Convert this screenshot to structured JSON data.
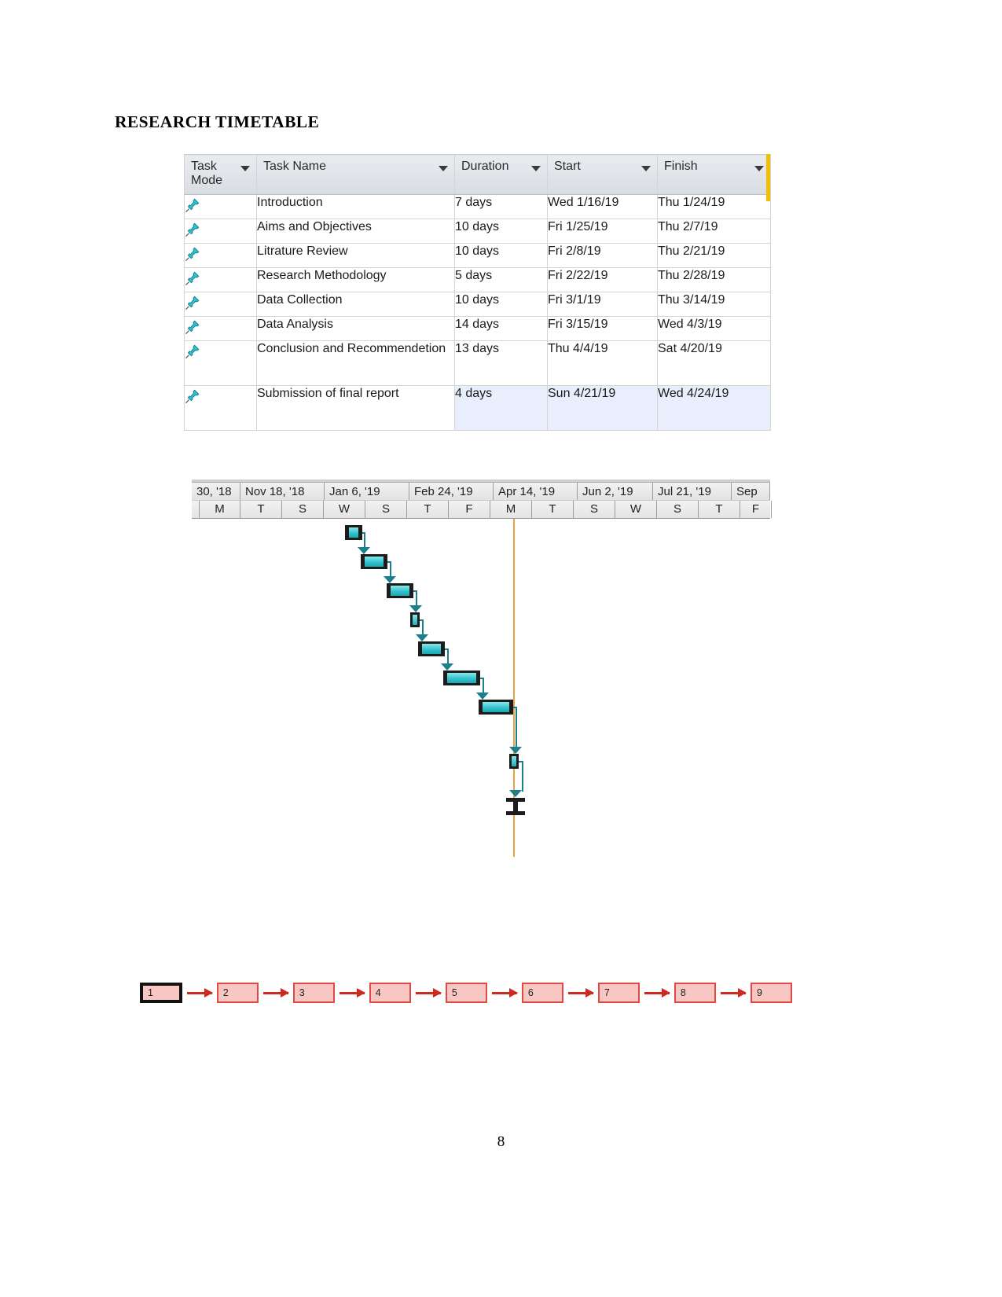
{
  "document": {
    "title": "RESEARCH TIMETABLE",
    "page_number": "8"
  },
  "project_table": {
    "columns": [
      {
        "key": "task_mode",
        "label": "Task\nMode",
        "label_line1": "Task",
        "label_line2": "Mode",
        "has_filter": true
      },
      {
        "key": "task_name",
        "label": "Task Name",
        "has_filter": true
      },
      {
        "key": "duration",
        "label": "Duration",
        "has_filter": true
      },
      {
        "key": "start",
        "label": "Start",
        "has_filter": true
      },
      {
        "key": "finish",
        "label": "Finish",
        "has_filter": true
      }
    ],
    "rows": [
      {
        "mode_icon": "pin-icon",
        "name": "Introduction",
        "duration": "7 days",
        "start": "Wed 1/16/19",
        "finish": "Thu 1/24/19",
        "selected": false
      },
      {
        "mode_icon": "pin-icon",
        "name": "Aims and Objectives",
        "duration": "10 days",
        "start": "Fri 1/25/19",
        "finish": "Thu 2/7/19",
        "selected": false
      },
      {
        "mode_icon": "pin-icon",
        "name": "Litrature Review",
        "duration": "10 days",
        "start": "Fri 2/8/19",
        "finish": "Thu 2/21/19",
        "selected": false
      },
      {
        "mode_icon": "pin-icon",
        "name": "Research Methodology",
        "duration": "5 days",
        "start": "Fri 2/22/19",
        "finish": "Thu 2/28/19",
        "selected": false
      },
      {
        "mode_icon": "pin-icon",
        "name": "Data Collection",
        "duration": "10 days",
        "start": "Fri 3/1/19",
        "finish": "Thu 3/14/19",
        "selected": false
      },
      {
        "mode_icon": "pin-icon",
        "name": "Data Analysis",
        "duration": "14 days",
        "start": "Fri 3/15/19",
        "finish": "Wed 4/3/19",
        "selected": false
      },
      {
        "mode_icon": "pin-icon",
        "name": "Conclusion and Recommendetion",
        "duration": "13 days",
        "start": "Thu 4/4/19",
        "finish": "Sat 4/20/19",
        "selected": false
      },
      {
        "mode_icon": "pin-icon",
        "name": "Submission of final report",
        "duration": "4 days",
        "start": "Sun 4/21/19",
        "finish": "Wed 4/24/19",
        "selected": true
      }
    ]
  },
  "gantt": {
    "timeline_major": [
      "30, '18",
      "Nov 18, '18",
      "Jan 6, '19",
      "Feb 24, '19",
      "Apr 14, '19",
      "Jun 2, '19",
      "Jul 21, '19",
      "Sep"
    ],
    "timeline_minor": [
      "",
      "M",
      "T",
      "S",
      "W",
      "S",
      "T",
      "F",
      "M",
      "T",
      "S",
      "W",
      "S",
      "T",
      "F"
    ],
    "today_line_color": "#e8a33d",
    "bar_color": "#35c3cc",
    "bar_border_color": "#1c1c1c",
    "link_color": "#1b7f8c",
    "bars": [
      {
        "task": "Introduction",
        "type": "task"
      },
      {
        "task": "Aims and Objectives",
        "type": "task"
      },
      {
        "task": "Litrature Review",
        "type": "task"
      },
      {
        "task": "Research Methodology",
        "type": "task"
      },
      {
        "task": "Data Collection",
        "type": "task"
      },
      {
        "task": "Data Analysis",
        "type": "task"
      },
      {
        "task": "Conclusion and Recommendetion",
        "type": "task"
      },
      {
        "task": "Submission of final report",
        "type": "task"
      },
      {
        "task": "",
        "type": "summary"
      }
    ]
  },
  "flow_diagram": {
    "box_fill": "#f8c6c3",
    "box_border": "#e04a42",
    "arrow_color": "#cc2a20",
    "nodes": [
      {
        "label": "1",
        "selected": true
      },
      {
        "label": "2",
        "selected": false
      },
      {
        "label": "3",
        "selected": false
      },
      {
        "label": "4",
        "selected": false
      },
      {
        "label": "5",
        "selected": false
      },
      {
        "label": "6",
        "selected": false
      },
      {
        "label": "7",
        "selected": false
      },
      {
        "label": "8",
        "selected": false
      },
      {
        "label": "9",
        "selected": false
      }
    ]
  }
}
